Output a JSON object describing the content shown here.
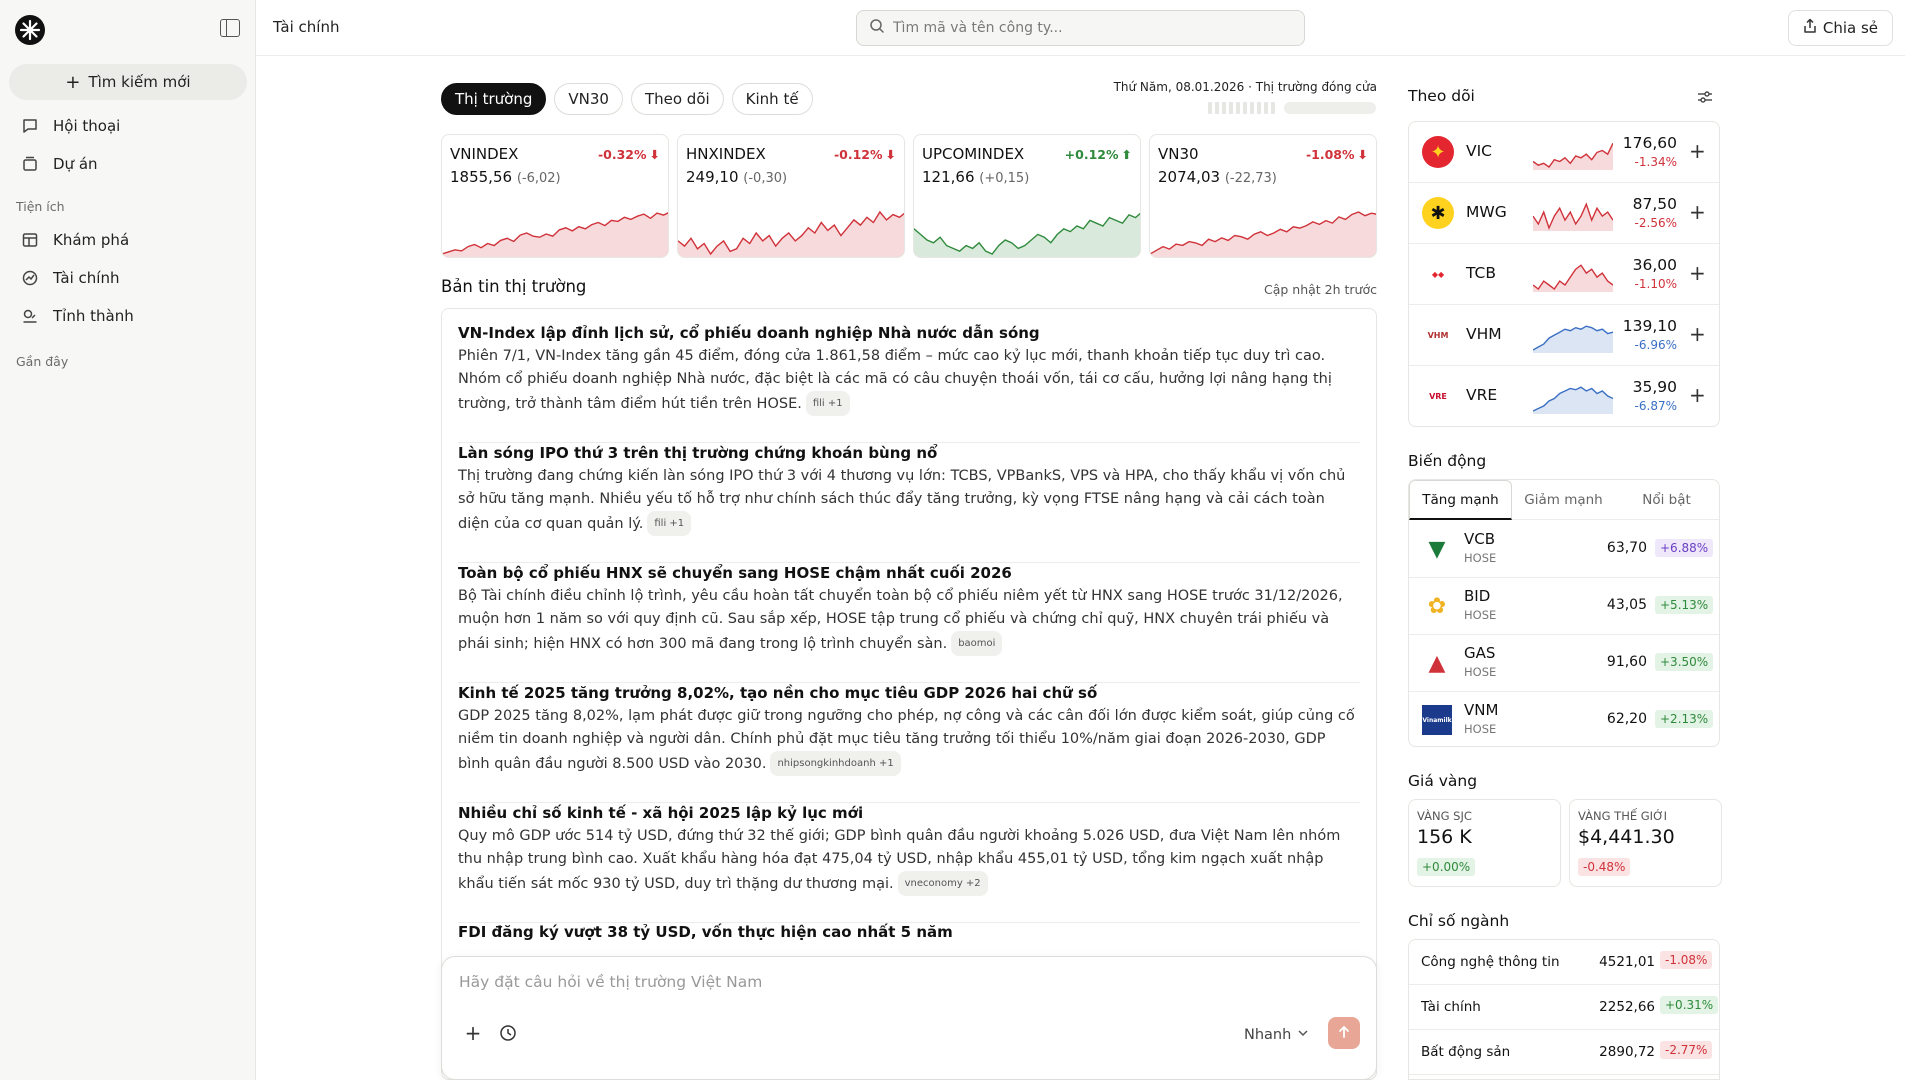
{
  "sidebar": {
    "new_search": "Tìm kiếm mới",
    "nav_main": [
      "Hội thoại",
      "Dự án"
    ],
    "section_tools": "Tiện ích",
    "nav_tools": [
      "Khám phá",
      "Tài chính",
      "Tỉnh thành"
    ],
    "section_recent": "Gần đây"
  },
  "header": {
    "title": "Tài chính",
    "search_placeholder": "Tìm mã và tên công ty...",
    "share_label": "Chia sẻ"
  },
  "tabs": [
    "Thị trường",
    "VN30",
    "Theo dõi",
    "Kinh tế"
  ],
  "date_status": "Thứ Năm, 08.01.2026 · Thị trường đóng cửa",
  "indices": [
    {
      "name": "VNINDEX",
      "pct": "-0.32%",
      "value": "1855,56",
      "change": "(-6,02)",
      "dir": "down",
      "series": [
        40,
        42,
        44,
        43,
        47,
        49,
        46,
        50,
        48,
        53,
        55,
        52,
        58,
        60,
        57,
        56,
        59,
        57,
        63,
        65,
        62,
        66,
        64,
        68,
        70,
        67,
        72,
        71,
        75,
        73,
        76,
        78,
        74,
        79,
        77,
        80
      ]
    },
    {
      "name": "HNXINDEX",
      "pct": "-0.12%",
      "value": "249,10",
      "change": "(-0,30)",
      "dir": "down",
      "series": [
        55,
        53,
        56,
        52,
        54,
        50,
        53,
        55,
        51,
        52,
        56,
        54,
        58,
        55,
        57,
        53,
        56,
        58,
        55,
        57,
        60,
        58,
        62,
        59,
        61,
        57,
        60,
        63,
        61,
        64,
        62,
        66,
        63,
        65,
        64,
        66
      ]
    },
    {
      "name": "UPCOMINDEX",
      "pct": "+0.12%",
      "value": "121,66",
      "change": "(+0,15)",
      "dir": "up",
      "series": [
        52,
        50,
        48,
        47,
        49,
        46,
        45,
        44,
        46,
        45,
        47,
        44,
        43,
        46,
        48,
        47,
        45,
        46,
        48,
        50,
        49,
        47,
        50,
        52,
        51,
        53,
        52,
        55,
        54,
        53,
        56,
        55,
        54,
        57,
        56,
        58
      ]
    },
    {
      "name": "VN30",
      "pct": "-1.08%",
      "value": "2074,03",
      "change": "(-22,73)",
      "dir": "down",
      "series": [
        40,
        43,
        46,
        44,
        48,
        47,
        50,
        49,
        47,
        52,
        50,
        53,
        51,
        55,
        54,
        52,
        56,
        58,
        55,
        57,
        60,
        58,
        62,
        61,
        63,
        66,
        64,
        67,
        65,
        70,
        68,
        72,
        74,
        71,
        73,
        72
      ]
    }
  ],
  "news_heading": "Bản tin thị trường",
  "news_updated": "Cập nhật 2h trước",
  "news": [
    {
      "title": "VN-Index lập đỉnh lịch sử, cổ phiếu doanh nghiệp Nhà nước dẫn sóng",
      "body": "Phiên 7/1, VN-Index tăng gần 45 điểm, đóng cửa 1.861,58 điểm – mức cao kỷ lục mới, thanh khoản tiếp tục duy trì cao. Nhóm cổ phiếu doanh nghiệp Nhà nước, đặc biệt là các mã có câu chuyện thoái vốn, tái cơ cấu, hưởng lợi nâng hạng thị trường, trở thành tâm điểm hút tiền trên HOSE.",
      "source": "fili +1"
    },
    {
      "title": "Làn sóng IPO thứ 3 trên thị trường chứng khoán bùng nổ",
      "body": "Thị trường đang chứng kiến làn sóng IPO thứ 3 với 4 thương vụ lớn: TCBS, VPBankS, VPS và HPA, cho thấy khẩu vị vốn chủ sở hữu tăng mạnh. Nhiều yếu tố hỗ trợ như chính sách thúc đẩy tăng trưởng, kỳ vọng FTSE nâng hạng và cải cách toàn diện của cơ quan quản lý.",
      "source": "fili +1"
    },
    {
      "title": "Toàn bộ cổ phiếu HNX sẽ chuyển sang HOSE chậm nhất cuối 2026",
      "body": "Bộ Tài chính điều chỉnh lộ trình, yêu cầu hoàn tất chuyển toàn bộ cổ phiếu niêm yết từ HNX sang HOSE trước 31/12/2026, muộn hơn 1 năm so với quy định cũ. Sau sắp xếp, HOSE tập trung cổ phiếu và chứng chỉ quỹ, HNX chuyên trái phiếu và phái sinh; hiện HNX có hơn 300 mã đang trong lộ trình chuyển sàn.",
      "source": "baomoi"
    },
    {
      "title": "Kinh tế 2025 tăng trưởng 8,02%, tạo nền cho mục tiêu GDP 2026 hai chữ số",
      "body": "GDP 2025 tăng 8,02%, lạm phát được giữ trong ngưỡng cho phép, nợ công và các cân đối lớn được kiểm soát, giúp củng cố niềm tin doanh nghiệp và người dân. Chính phủ đặt mục tiêu tăng trưởng tối thiểu 10%/năm giai đoạn 2026-2030, GDP bình quân đầu người 8.500 USD vào 2030.",
      "source": "nhipsongkinhdoanh +1"
    },
    {
      "title": "Nhiều chỉ số kinh tế - xã hội 2025 lập kỷ lục mới",
      "body": "Quy mô GDP ước 514 tỷ USD, đứng thứ 32 thế giới; GDP bình quân đầu người khoảng 5.026 USD, đưa Việt Nam lên nhóm thu nhập trung bình cao. Xuất khẩu hàng hóa đạt 475,04 tỷ USD, nhập khẩu 455,01 tỷ USD, tổng kim ngạch xuất nhập khẩu tiến sát mốc 930 tỷ USD, duy trì thặng dư thương mại.",
      "source": "vneconomy +2"
    },
    {
      "title": "FDI đăng ký vượt 38 tỷ USD, vốn thực hiện cao nhất 5 năm",
      "body": "",
      "source": ""
    }
  ],
  "chat": {
    "placeholder": "Hãy đặt câu hỏi về thị trường Việt Nam",
    "speed_label": "Nhanh"
  },
  "watchlist_heading": "Theo dõi",
  "watchlist": [
    {
      "symbol": "VIC",
      "price": "176,60",
      "change": "-1.34%",
      "dir": "down",
      "logo_bg": "#e3262f",
      "logo_fg": "#ffd21f",
      "logo_text": "✦",
      "series": [
        20,
        18,
        19,
        17,
        21,
        20,
        22,
        19,
        23,
        22,
        24,
        21,
        25,
        26,
        24,
        30
      ]
    },
    {
      "symbol": "MWG",
      "price": "87,50",
      "change": "-2.56%",
      "dir": "down",
      "logo_bg": "#ffd21f",
      "logo_fg": "#111",
      "logo_text": "✱",
      "series": [
        22,
        20,
        23,
        19,
        22,
        24,
        21,
        23,
        20,
        22,
        25,
        21,
        24,
        22,
        23,
        21
      ]
    },
    {
      "symbol": "TCB",
      "price": "36,00",
      "change": "-1.10%",
      "dir": "down",
      "logo_bg": "#ffffff",
      "logo_fg": "#e3262f",
      "logo_text": "◆◆",
      "series": [
        18,
        17,
        19,
        18,
        17,
        19,
        18,
        20,
        22,
        23,
        21,
        22,
        20,
        21,
        19,
        18
      ]
    },
    {
      "symbol": "VHM",
      "price": "139,10",
      "change": "-6.96%",
      "dir": "down",
      "logo_bg": "#ffffff",
      "logo_fg": "#b03030",
      "logo_text": "VHM",
      "series": [
        10,
        12,
        14,
        18,
        20,
        22,
        24,
        23,
        25,
        24,
        26,
        25,
        23,
        24,
        21,
        22
      ]
    },
    {
      "symbol": "VRE",
      "price": "35,90",
      "change": "-6.87%",
      "dir": "down",
      "logo_bg": "#ffffff",
      "logo_fg": "#c8102e",
      "logo_text": "VRE",
      "series": [
        8,
        10,
        12,
        16,
        18,
        22,
        24,
        26,
        25,
        27,
        24,
        26,
        22,
        24,
        20,
        18
      ]
    }
  ],
  "movers_heading": "Biến động",
  "movers_tabs": [
    "Tăng mạnh",
    "Giảm mạnh",
    "Nổi bật"
  ],
  "movers": [
    {
      "symbol": "VCB",
      "exchange": "HOSE",
      "price": "63,70",
      "change": "+6.88%",
      "pill": "p",
      "logo_fg": "#1c7a3a",
      "logo_text": "▼"
    },
    {
      "symbol": "BID",
      "exchange": "HOSE",
      "price": "43,05",
      "change": "+5.13%",
      "pill": "g",
      "logo_fg": "#f0b323",
      "logo_text": "✿"
    },
    {
      "symbol": "GAS",
      "exchange": "HOSE",
      "price": "91,60",
      "change": "+3.50%",
      "pill": "g",
      "logo_fg": "#d0323a",
      "logo_text": "▲"
    },
    {
      "symbol": "VNM",
      "exchange": "HOSE",
      "price": "62,20",
      "change": "+2.13%",
      "pill": "g",
      "logo_fg": "#ffffff",
      "logo_text": "Vinamilk"
    }
  ],
  "gold_heading": "Giá vàng",
  "gold": [
    {
      "label": "VÀNG SJC",
      "value": "156 K",
      "change": "+0.00%",
      "pill": "g"
    },
    {
      "label": "VÀNG THẾ GIỚI",
      "value": "$4,441.30",
      "change": "-0.48%",
      "pill": "r"
    }
  ],
  "sectors_heading": "Chỉ số ngành",
  "sectors": [
    {
      "name": "Công nghệ thông tin",
      "value": "4521,01",
      "change": "-1.08%",
      "pill": "r"
    },
    {
      "name": "Tài chính",
      "value": "2252,66",
      "change": "+0.31%",
      "pill": "g"
    },
    {
      "name": "Bất động sản",
      "value": "2890,72",
      "change": "-2.77%",
      "pill": "r"
    }
  ],
  "colors": {
    "down": "#d0323a",
    "up": "#2f8a3c",
    "accent": "#111111",
    "send": "#e8a796",
    "spark_blue": "#3a6fc4"
  }
}
